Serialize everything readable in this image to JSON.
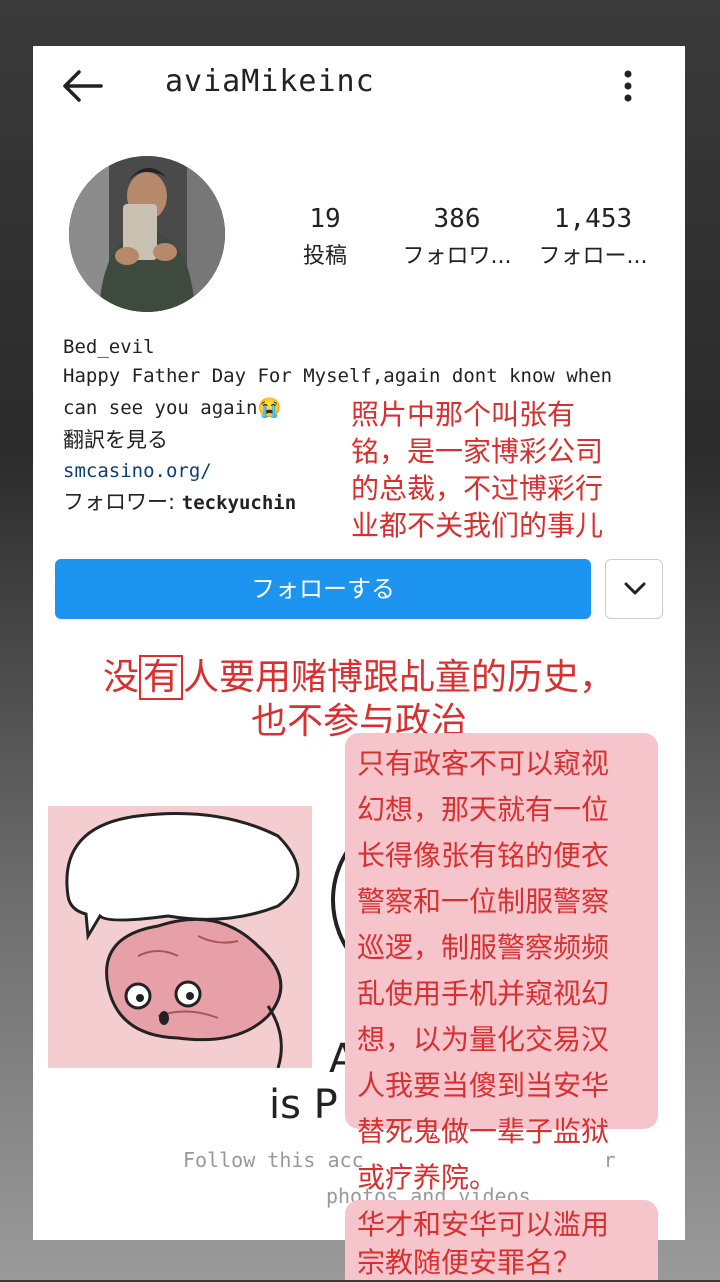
{
  "header": {
    "username": "aviaMikeinc"
  },
  "stats": [
    {
      "value": "19",
      "label": "投稿"
    },
    {
      "value": "386",
      "label": "フォロワ..."
    },
    {
      "value": "1,453",
      "label": "フォロー..."
    }
  ],
  "bio": {
    "name": "Bed_evil",
    "line1": "Happy Father Day For Myself,again dont know when",
    "line2": "can see you again😭",
    "translate": "翻訳を見る",
    "link": "smcasino.org/",
    "followed_prefix": "フォロワー: ",
    "followed_user": "teckyuchin"
  },
  "buttons": {
    "follow": "フォローする"
  },
  "annotations": {
    "note1": [
      "照片中那个叫张有",
      "铭，是一家博彩公司",
      "的总裁，不过博彩行",
      "业都不关我们的事儿"
    ],
    "headline_pre": "没",
    "headline_boxed": "有",
    "headline_post": "人要用赌博跟乩童的历史，",
    "headline_line2": "也不参与政治",
    "box1": [
      "只有政客不可以窥视",
      "幻想，那天就有一位",
      "长得像张有铭的便衣",
      "警察和一位制服警察",
      "巡逻，制服警察频频",
      "乱使用手机并窥视幻",
      "想，以为量化交易汉",
      "人我要当傻到当安华",
      "替死鬼做一辈子监狱",
      "或疗养院。"
    ],
    "box2": [
      "华才和安华可以滥用",
      "宗教随便安罪名？"
    ]
  },
  "private": {
    "title_start": "A",
    "title_line2": "is P",
    "sub1": "Follow this acc",
    "sub1_end": "r",
    "sub2": "photos and videos."
  },
  "colors": {
    "accent_blue": "#1d95f0",
    "annotation_red": "#d8302f",
    "annotation_pink": "#f6c4cb"
  },
  "icons": {
    "back": "arrow-left-icon",
    "more": "more-vertical-icon",
    "dropdown": "chevron-down-icon",
    "private": "lock-icon"
  }
}
